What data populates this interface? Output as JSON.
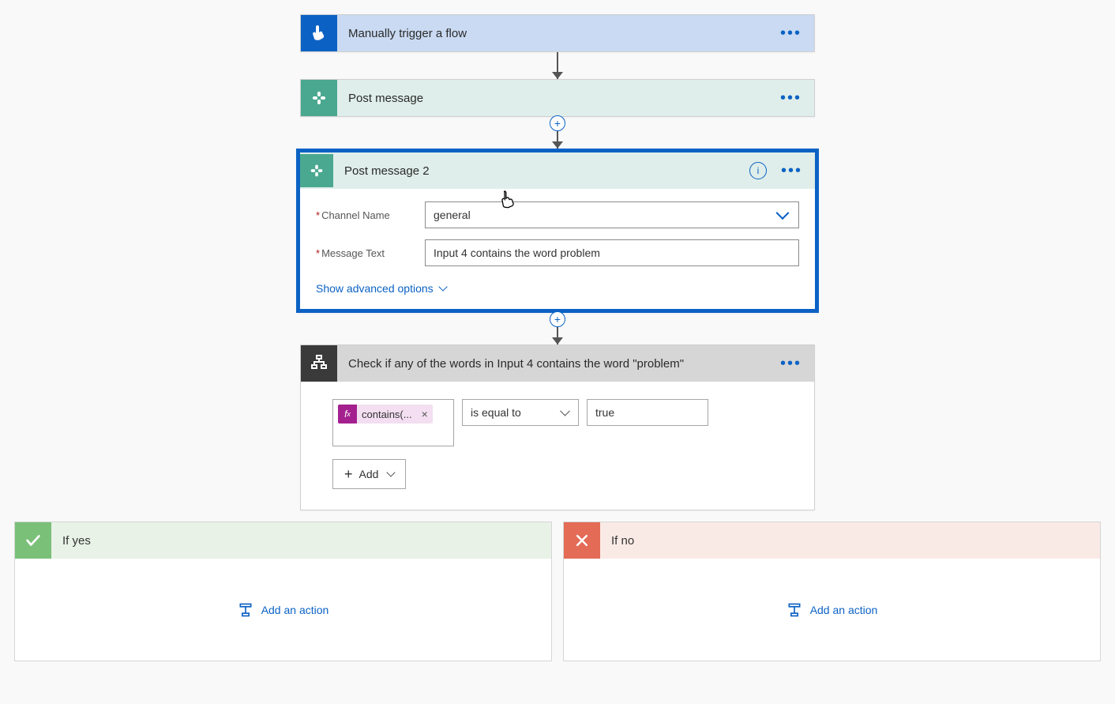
{
  "trigger": {
    "title": "Manually trigger a flow"
  },
  "post_message": {
    "title": "Post message"
  },
  "post_message_2": {
    "title": "Post message 2",
    "fields": {
      "channel_label": "Channel Name",
      "channel_value": "general",
      "message_label": "Message Text",
      "message_value": "Input 4 contains the word problem"
    },
    "show_advanced": "Show advanced options"
  },
  "condition": {
    "title": "Check if any of the words in Input 4 contains the word \"problem\"",
    "expr_badge": "contains(...",
    "operator": "is equal to",
    "value": "true",
    "add_button": "Add"
  },
  "branches": {
    "yes": {
      "title": "If yes",
      "add": "Add an action"
    },
    "no": {
      "title": "If no",
      "add": "Add an action"
    }
  }
}
